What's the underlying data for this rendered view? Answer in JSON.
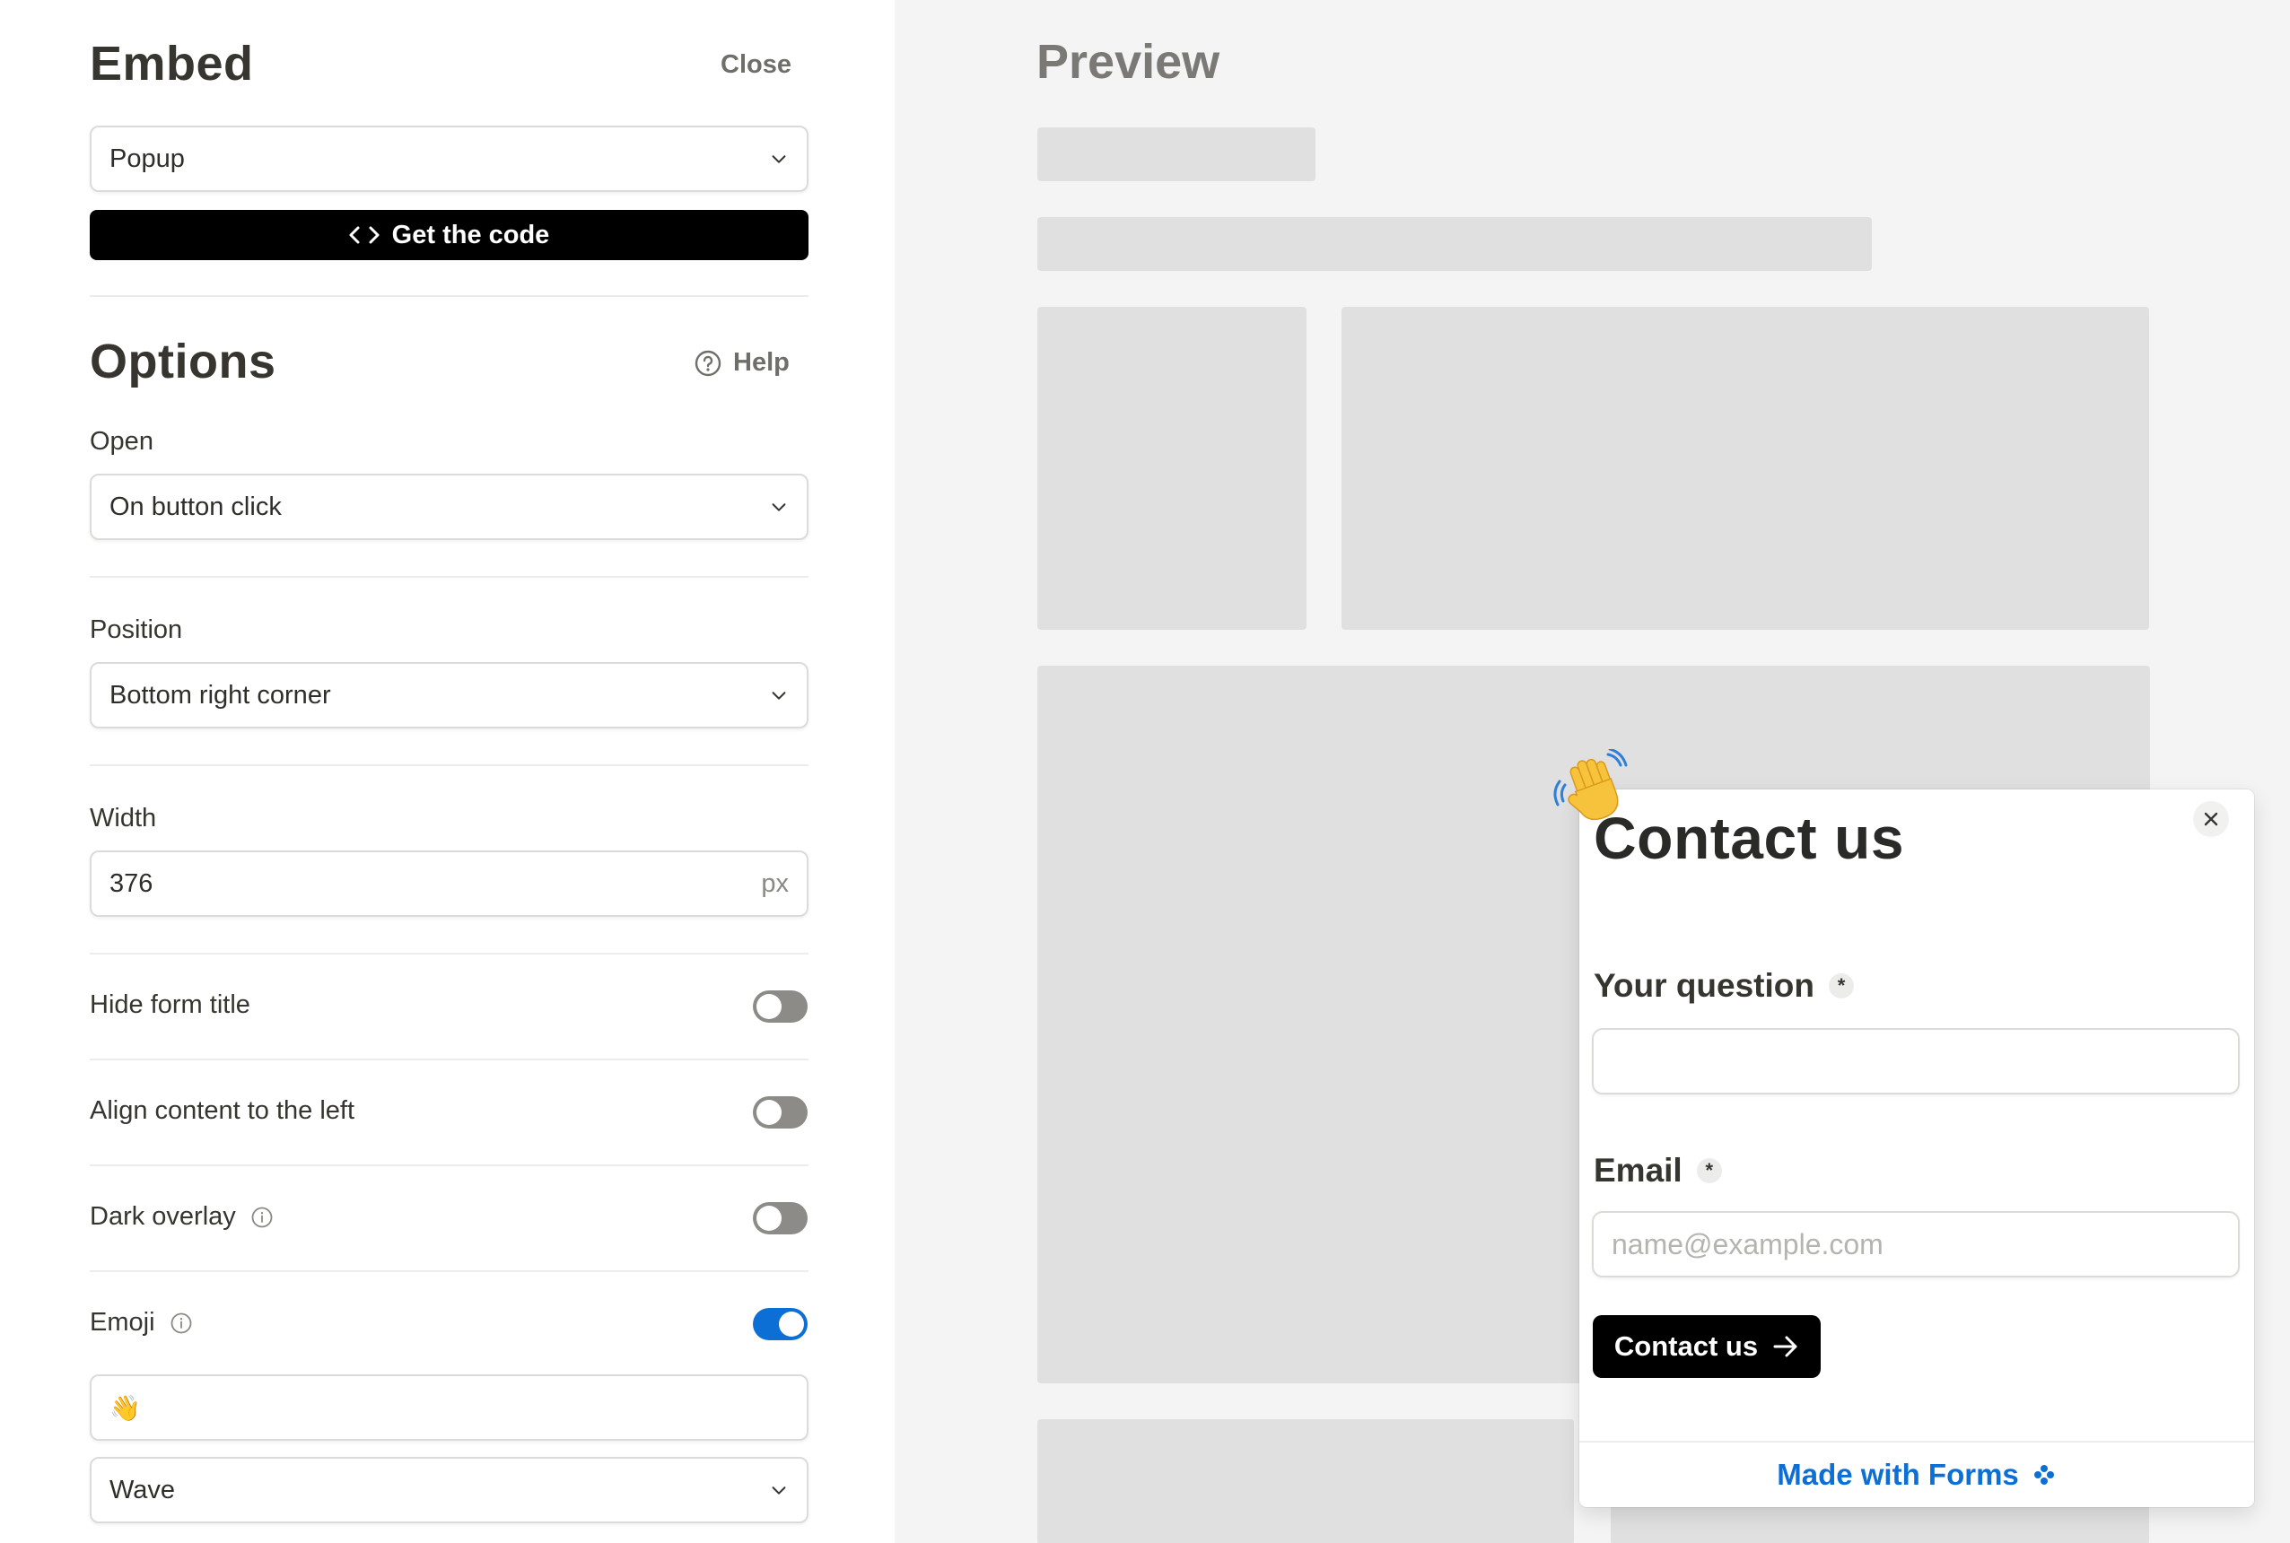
{
  "embed": {
    "title": "Embed",
    "close_label": "Close",
    "mode_value": "Popup",
    "get_code_label": "Get the code"
  },
  "options": {
    "title": "Options",
    "help_label": "Help",
    "open": {
      "label": "Open",
      "value": "On button click"
    },
    "position": {
      "label": "Position",
      "value": "Bottom right corner"
    },
    "width": {
      "label": "Width",
      "value": "376",
      "unit": "px"
    },
    "toggles": [
      {
        "label": "Hide form title",
        "on": false
      },
      {
        "label": "Align content to the left",
        "on": false
      },
      {
        "label": "Dark overlay",
        "on": false,
        "info": true
      },
      {
        "label": "Emoji",
        "on": true,
        "info": true
      }
    ],
    "emoji_value": "👋",
    "animation_value": "Wave"
  },
  "preview": {
    "title": "Preview",
    "popup": {
      "title": "Contact us",
      "question_label": "Your question",
      "email_label": "Email",
      "required_mark": "*",
      "email_placeholder": "name@example.com",
      "submit_label": "Contact us",
      "footer_label": "Made with Forms"
    }
  },
  "colors": {
    "accent": "#0b6fd6",
    "toggle_off": "#8c8b87",
    "button_bg": "#000000",
    "placeholder_block": "#e0e0e0"
  }
}
